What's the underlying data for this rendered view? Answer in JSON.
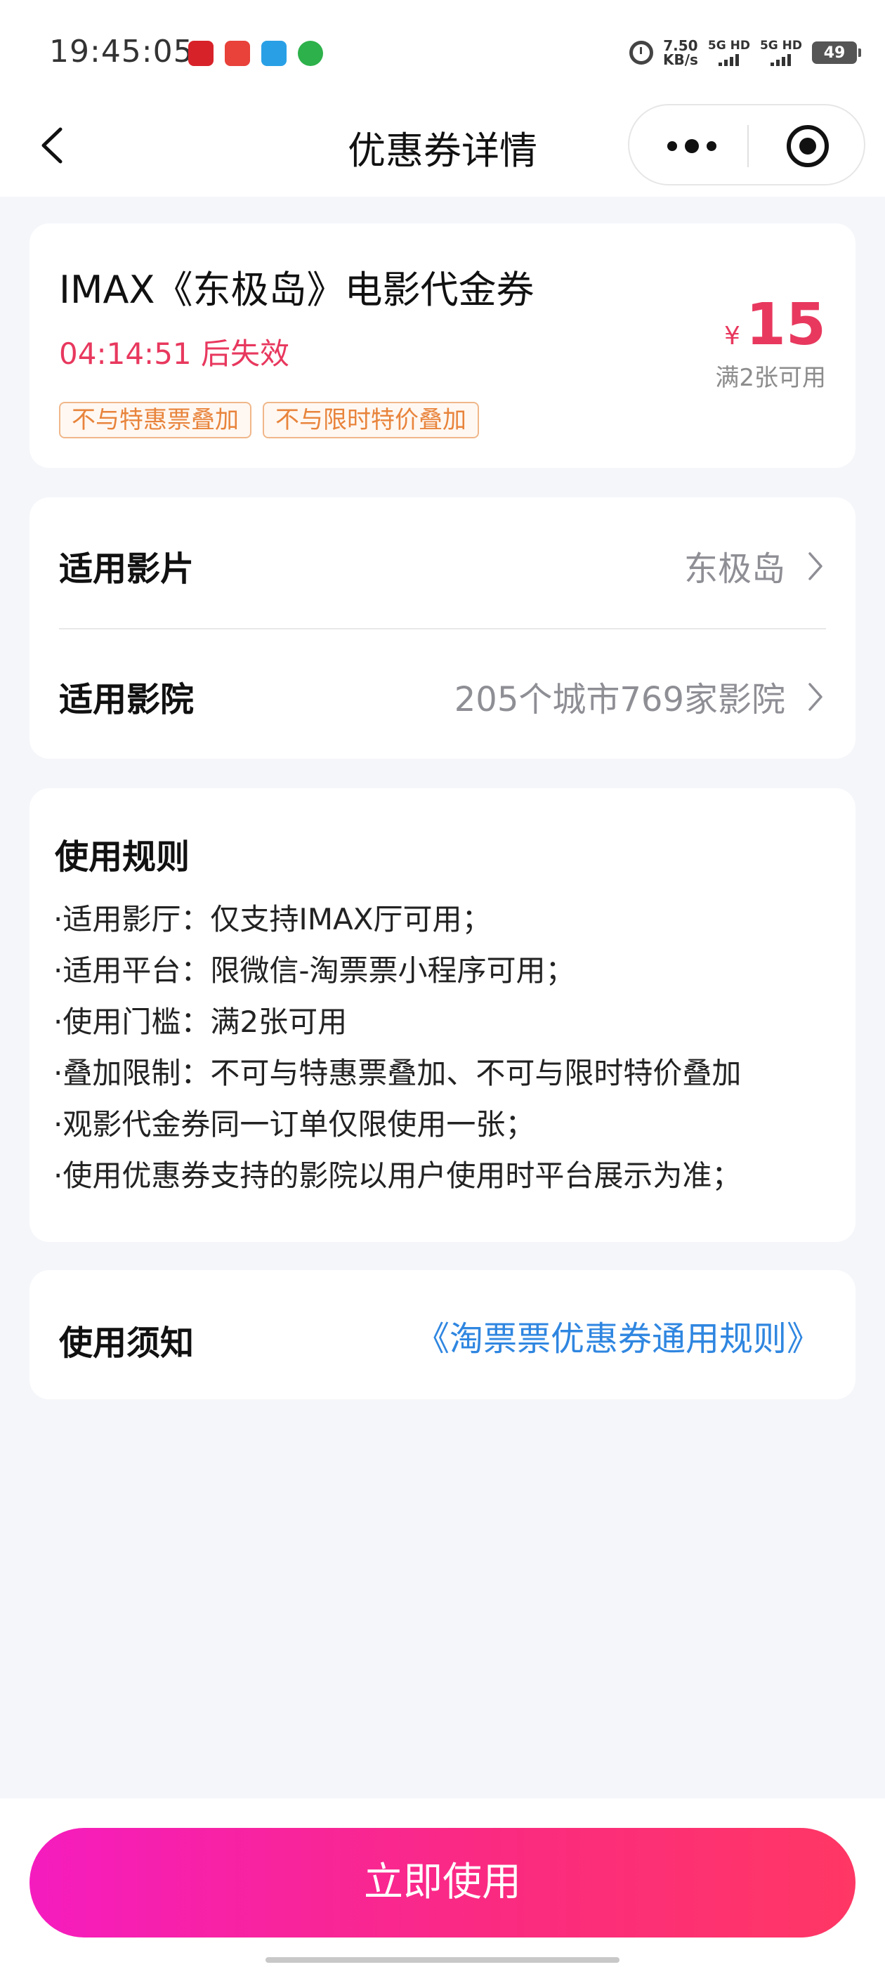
{
  "status_bar": {
    "time": "19:45:05",
    "net_speed_value": "7.50",
    "net_speed_unit": "KB/s",
    "signal1_label": "5G HD",
    "signal2_label": "5G HD",
    "battery": "49"
  },
  "nav": {
    "title": "优惠券详情"
  },
  "coupon": {
    "title": "IMAX《东极岛》电影代金券",
    "countdown": "04:14:51 后失效",
    "tags": [
      "不与特惠票叠加",
      "不与限时特价叠加"
    ],
    "currency": "¥",
    "amount": "15",
    "threshold": "满2张可用"
  },
  "applicable": {
    "film_label": "适用影片",
    "film_value": "东极岛",
    "cinema_label": "适用影院",
    "cinema_value": "205个城市769家影院"
  },
  "rules": {
    "heading": "使用规则",
    "items": [
      "·适用影厅：仅支持IMAX厅可用；",
      "·适用平台：限微信-淘票票小程序可用；",
      "·使用门槛：满2张可用",
      "·叠加限制：不可与特惠票叠加、不可与限时特价叠加",
      "·观影代金券同一订单仅限使用一张；",
      "·使用优惠券支持的影院以用户使用时平台展示为准；"
    ]
  },
  "notice": {
    "label": "使用须知",
    "link": "《淘票票优惠券通用规则》"
  },
  "footer": {
    "button": "立即使用"
  },
  "colors": {
    "accent_red": "#e8385e",
    "tag_orange": "#e8843c",
    "link_blue": "#2f86e0",
    "button_gradient_start": "#f51cbf",
    "button_gradient_end": "#ff3764"
  }
}
